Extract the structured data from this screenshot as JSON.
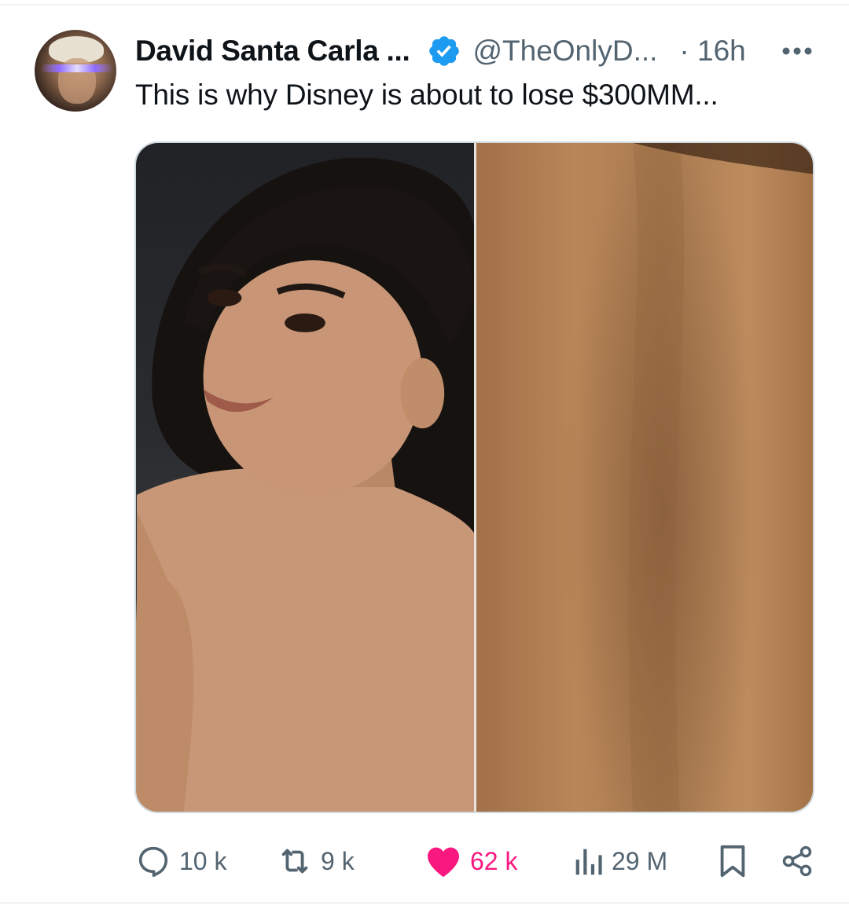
{
  "post": {
    "author_name": "David Santa Carla ...",
    "handle": "@TheOnlyD...",
    "time": "· 16h",
    "text": "This is why Disney is about to lose $300MM...",
    "more_icon": "more-horizontal-icon",
    "verified_icon": "verified-badge-icon",
    "verified_color": "#1d9bf0"
  },
  "media": {
    "description_left": "portrait-photo",
    "description_right": "back-skin-closeup"
  },
  "actions": {
    "replies": "10 k",
    "reposts": "9 k",
    "likes": "62 k",
    "views": "29 M",
    "like_color": "#f91880",
    "icon_color": "#536471",
    "icons": [
      "reply-icon",
      "repost-icon",
      "like-icon",
      "views-icon",
      "bookmark-icon",
      "share-icon"
    ]
  }
}
